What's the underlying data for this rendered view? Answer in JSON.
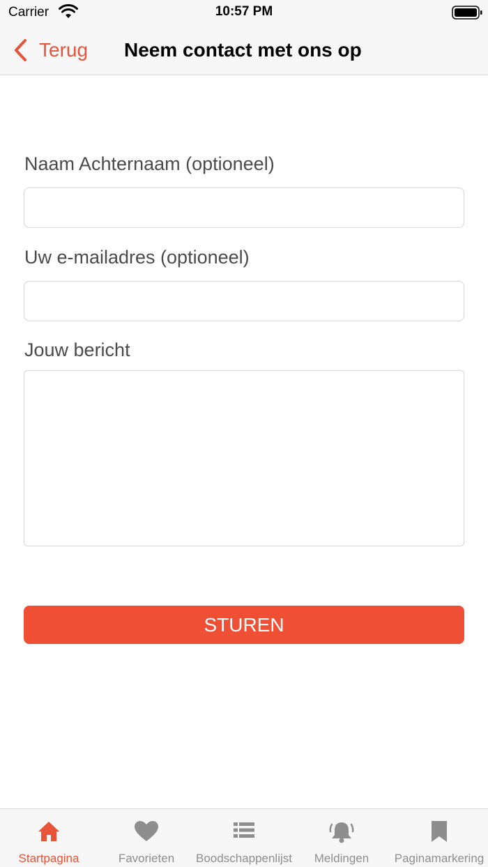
{
  "status_bar": {
    "carrier": "Carrier",
    "time": "10:57 PM"
  },
  "nav": {
    "back_label": "Terug",
    "title": "Neem contact met ons op"
  },
  "form": {
    "name_label": "Naam Achternaam (optioneel)",
    "name_value": "",
    "email_label": "Uw e-mailadres (optioneel)",
    "email_value": "",
    "message_label": "Jouw bericht",
    "message_value": "",
    "submit_label": "STUREN"
  },
  "tabs": [
    {
      "label": "Startpagina",
      "icon": "home-icon",
      "active": true
    },
    {
      "label": "Favorieten",
      "icon": "heart-icon",
      "active": false
    },
    {
      "label": "Boodschappenlijst",
      "icon": "list-icon",
      "active": false
    },
    {
      "label": "Meldingen",
      "icon": "bell-icon",
      "active": false
    },
    {
      "label": "Paginamarkering",
      "icon": "bookmark-icon",
      "active": false
    }
  ],
  "colors": {
    "accent": "#e8533a",
    "button": "#ef5035",
    "inactive": "#8e8e8e"
  }
}
